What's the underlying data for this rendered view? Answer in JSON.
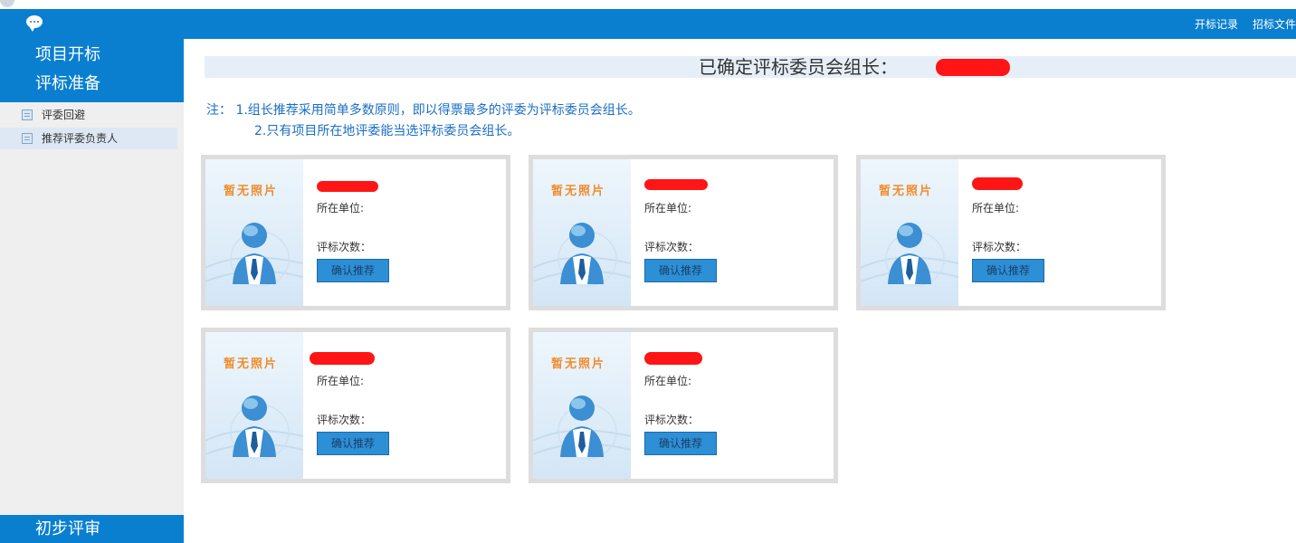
{
  "topbar": {
    "links": [
      "开标记录",
      "招标文件"
    ]
  },
  "sidebar": {
    "sections": [
      "项目开标",
      "评标准备"
    ],
    "items": [
      {
        "label": "评委回避"
      },
      {
        "label": "推荐评委负责人"
      }
    ],
    "bottom_section": "初步评审"
  },
  "main": {
    "title": "已确定评标委员会组长：",
    "notes": [
      "注： 1.组长推荐采用简单多数原则，即以得票最多的评委为评标委员会组长。",
      "2.只有项目所在地评委能当选评标委员会组长。"
    ],
    "cards": [
      {
        "no_photo": "暂无照片",
        "unit_label": "所在单位:",
        "count_label": "评标次数：",
        "button": "确认推荐"
      },
      {
        "no_photo": "暂无照片",
        "unit_label": "所在单位:",
        "count_label": "评标次数：",
        "button": "确认推荐"
      },
      {
        "no_photo": "暂无照片",
        "unit_label": "所在单位:",
        "count_label": "评标次数：",
        "button": "确认推荐"
      },
      {
        "no_photo": "暂无照片",
        "unit_label": "所在单位:",
        "count_label": "评标次数：",
        "button": "确认推荐"
      },
      {
        "no_photo": "暂无照片",
        "unit_label": "所在单位:",
        "count_label": "评标次数：",
        "button": "确认推荐"
      }
    ]
  },
  "colors": {
    "accent": "#0a7fd0",
    "note": "#1a6fc4",
    "no_photo": "#f08c2c",
    "redaction": "#ff1515"
  },
  "icons": [
    "chat-icon",
    "document-icon",
    "person-icon"
  ]
}
